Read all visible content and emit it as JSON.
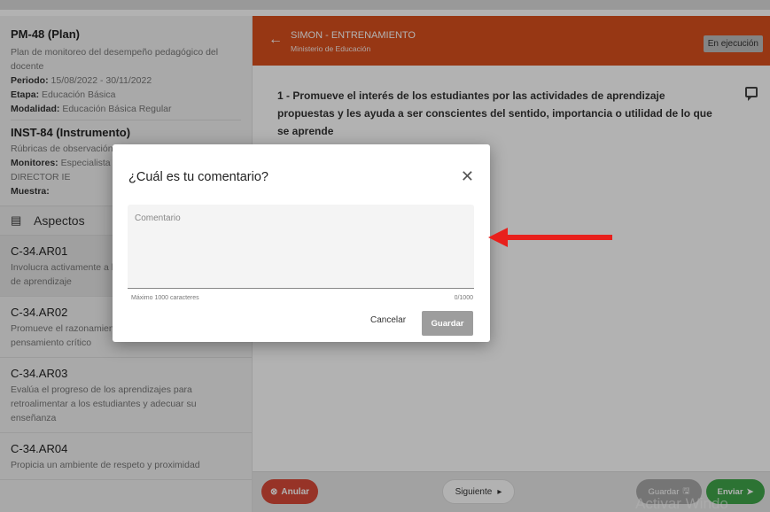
{
  "sidebar": {
    "plan_title": "PM-48 (Plan)",
    "plan_desc": "Plan de monitoreo del desempeño pedagógico del docente",
    "periodo_label": "Periodo:",
    "periodo_value": "15/08/2022 - 30/11/2022",
    "etapa_label": "Etapa:",
    "etapa_value": "Educación Básica",
    "modalidad_label": "Modalidad:",
    "modalidad_value": "Educación Básica Regular",
    "inst_title": "INST-84 (Instrumento)",
    "inst_desc": "Rúbricas de observación de aula",
    "monitores_label": "Monitores:",
    "monitores_value": "Especialista DRE/UGEL,",
    "monitores_value2": "DIRECTOR IE",
    "muestra_label": "Muestra:",
    "aspects_label": "Aspectos",
    "items": [
      {
        "code": "C-34.AR01",
        "text": "Involucra activamente a los estudiantes en el proceso de aprendizaje"
      },
      {
        "code": "C-34.AR02",
        "text": "Promueve el razonamiento, la creatividad y/o el pensamiento crítico"
      },
      {
        "code": "C-34.AR03",
        "text": "Evalúa el progreso de los aprendizajes para retroalimentar a los estudiantes y adecuar su enseñanza"
      },
      {
        "code": "C-34.AR04",
        "text": "Propicia un ambiente de respeto y proximidad"
      }
    ]
  },
  "header": {
    "back_icon": "←",
    "title": "SIMON - ENTRENAMIENTO",
    "subtitle": "Ministerio de Educación",
    "status": "En ejecución"
  },
  "main": {
    "question": "1 - Promueve el interés de los estudiantes por las actividades de aprendizaje propuestas y les ayuda a ser conscientes del sentido, importancia o utilidad de lo que se aprende"
  },
  "footer": {
    "anular": "Anular",
    "siguiente": "Siguiente",
    "guardar": "Guardar",
    "enviar": "Enviar",
    "watermark": "Activar Windo"
  },
  "dialog": {
    "title": "¿Cuál es tu comentario?",
    "close_icon": "✕",
    "placeholder": "Comentario",
    "helper": "Máximo 1000 caracteres",
    "counter": "0/1000",
    "cancel": "Cancelar",
    "save": "Guardar"
  },
  "colors": {
    "header": "#d94f1e",
    "anular": "#d94a39",
    "enviar": "#3fa54a",
    "arrow": "#e8201c"
  }
}
